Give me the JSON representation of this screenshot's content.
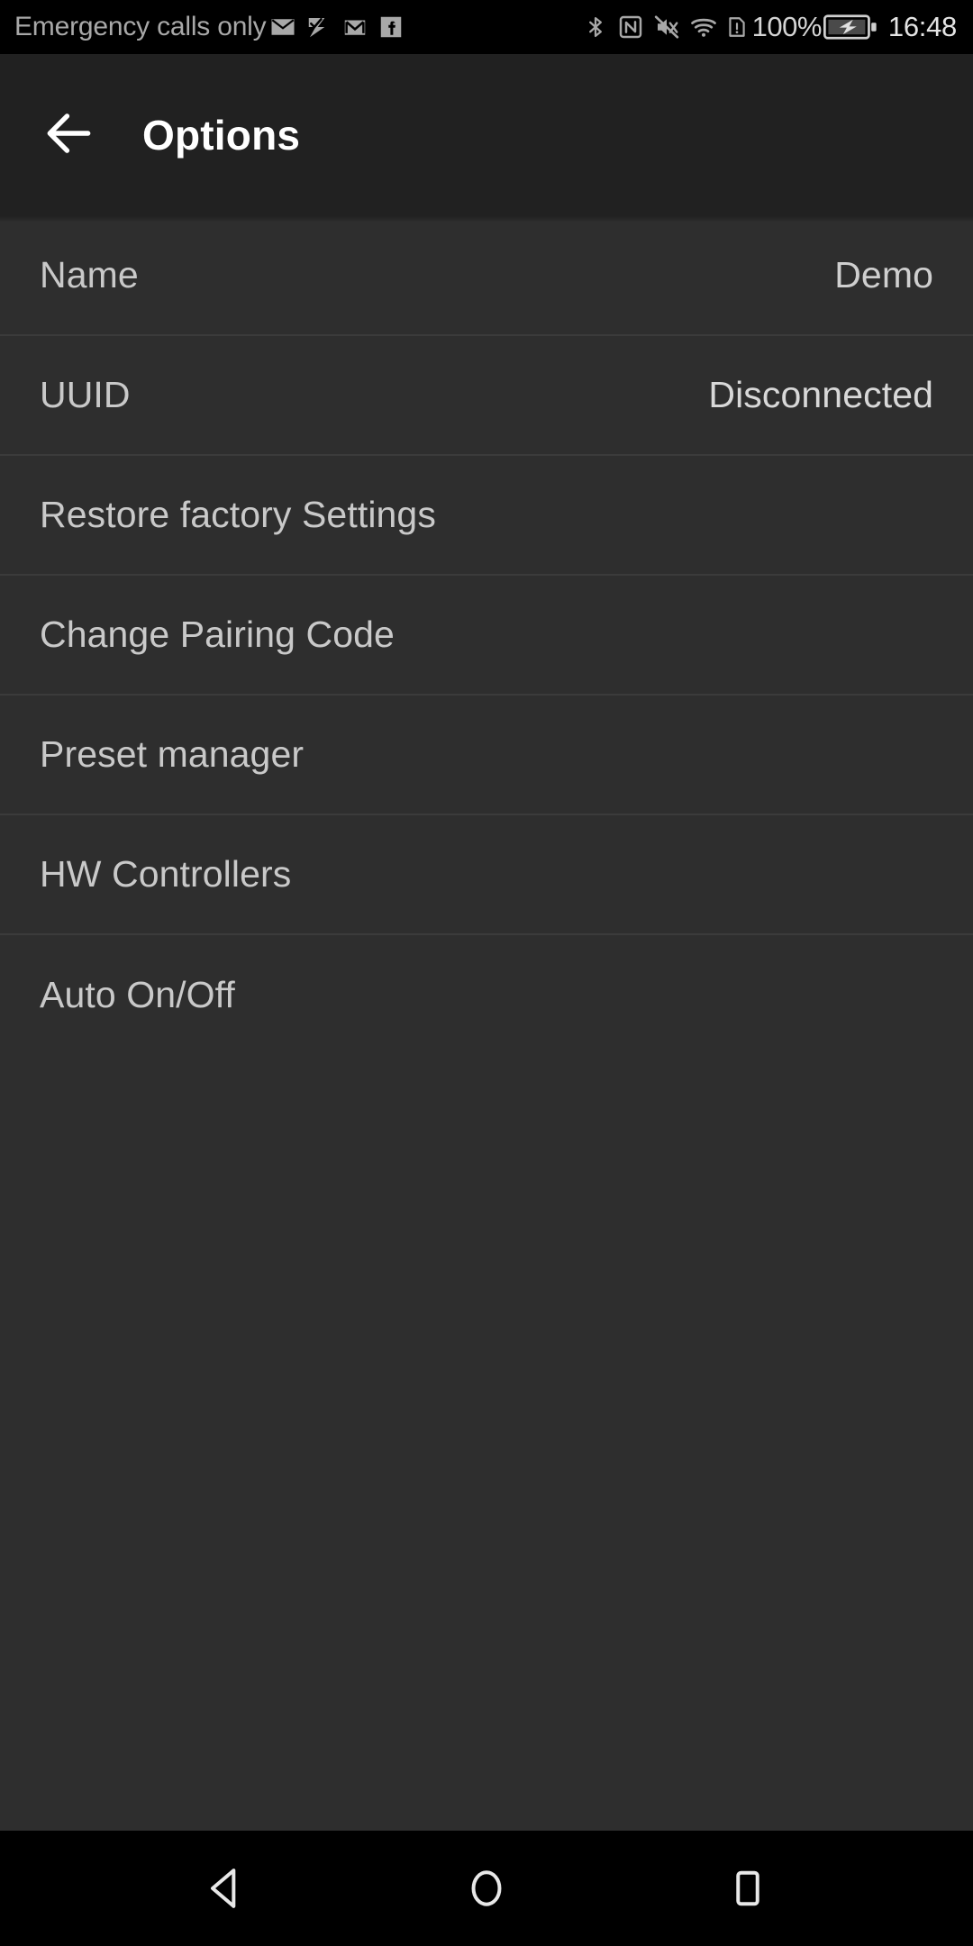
{
  "status_bar": {
    "carrier": "Emergency calls only",
    "notification_icons": [
      "email-icon",
      "tasks-check-icon",
      "gmail-icon",
      "facebook-icon"
    ],
    "system_icons": [
      "bluetooth-icon",
      "nfc-icon",
      "volume-mute-icon",
      "wifi-icon",
      "sim-alert-icon"
    ],
    "battery_percent": "100%",
    "battery_state_icon": "battery-charging-icon",
    "time": "16:48"
  },
  "app_bar": {
    "back_icon": "arrow-left-icon",
    "title": "Options"
  },
  "list": {
    "rows": [
      {
        "label": "Name",
        "value": "Demo"
      },
      {
        "label": "UUID",
        "value": "Disconnected"
      },
      {
        "label": "Restore factory Settings",
        "value": ""
      },
      {
        "label": "Change Pairing Code",
        "value": ""
      },
      {
        "label": "Preset manager",
        "value": ""
      },
      {
        "label": "HW Controllers",
        "value": ""
      },
      {
        "label": "Auto On/Off",
        "value": ""
      }
    ]
  },
  "nav_bar": {
    "back_label": "back-nav",
    "home_label": "home-nav",
    "recents_label": "recents-nav"
  },
  "colors": {
    "status_bar_bg": "#000000",
    "app_bar_bg": "#212121",
    "content_bg": "#2e2e2e",
    "divider": "#3b3b3b",
    "primary_text": "#ffffff",
    "list_text": "#c9c9c9",
    "status_text": "#a8a8a8"
  }
}
